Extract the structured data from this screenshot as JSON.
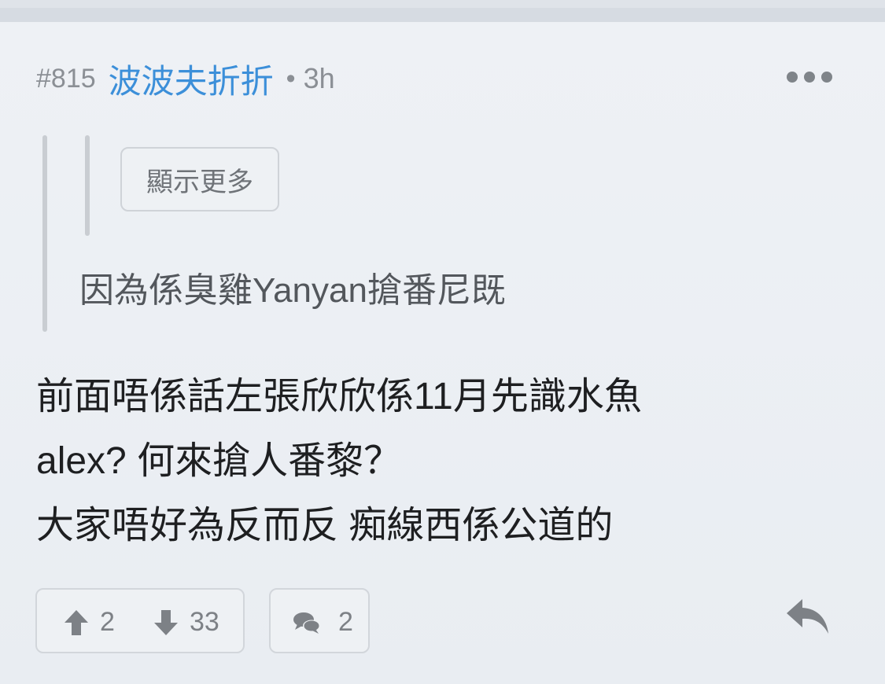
{
  "post": {
    "number": "#815",
    "username": "波波夫折折",
    "separator": "•",
    "time": "3h"
  },
  "quote": {
    "show_more_label": "顯示更多",
    "text": "因為係臭雞Yanyan搶番尼既"
  },
  "body": {
    "lines": [
      "前面唔係話左張欣欣係11月先識水魚",
      "alex? 何來搶人番黎？",
      "大家唔好為反而反 痴線西係公道的"
    ]
  },
  "actions": {
    "upvotes": "2",
    "downvotes": "33",
    "comments": "2"
  },
  "icons": {
    "more": "more-horizontal-icon",
    "upvote": "arrow-up-icon",
    "downvote": "arrow-down-icon",
    "comment": "comment-bubbles-icon",
    "reply": "reply-icon"
  },
  "colors": {
    "username": "#3c8fd9",
    "meta": "#8b8f95",
    "body": "#1e1f21"
  }
}
